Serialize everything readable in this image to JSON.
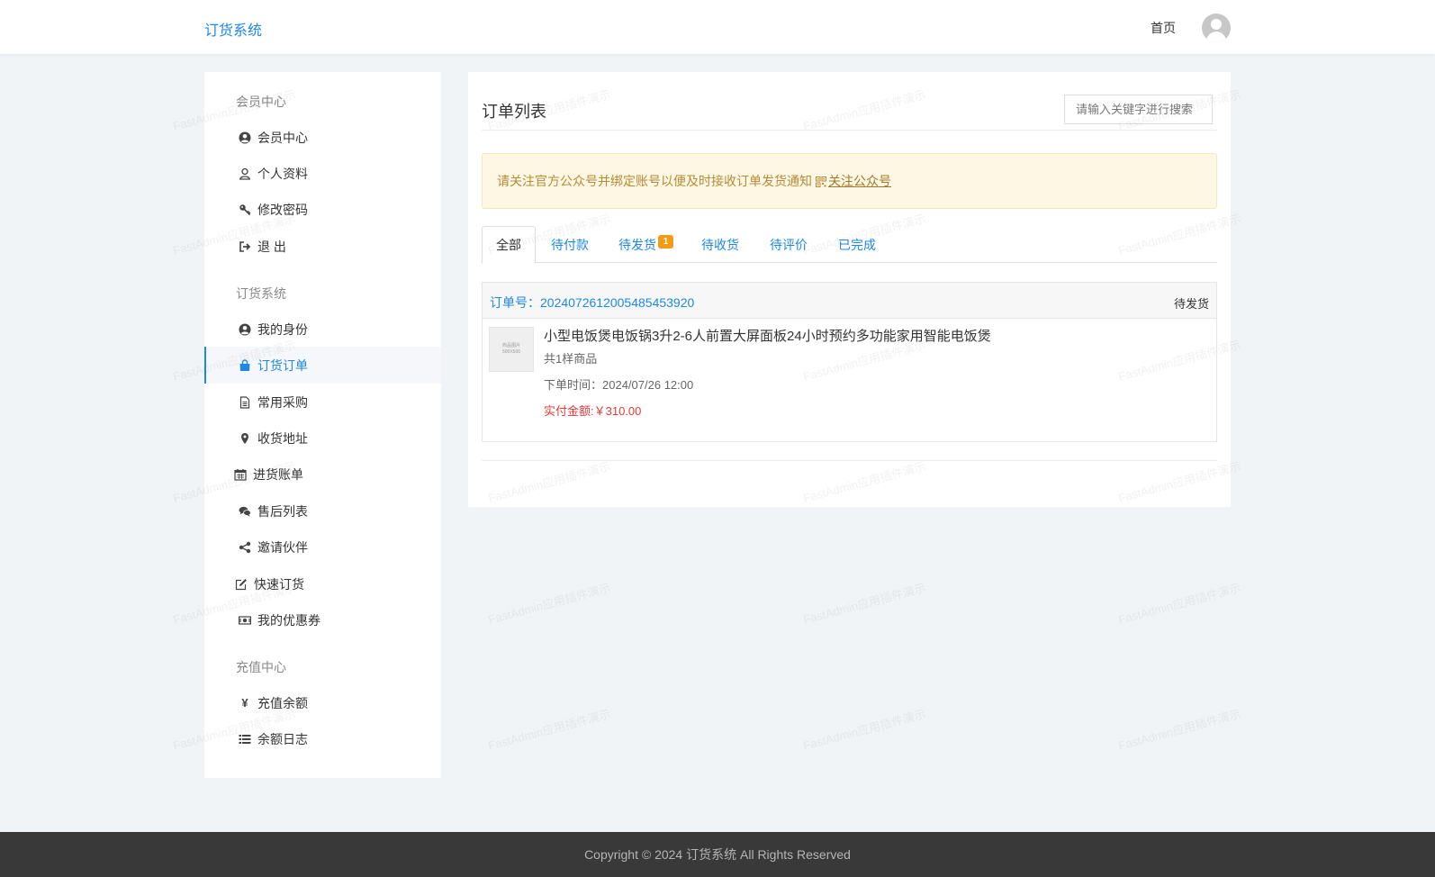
{
  "header": {
    "brand": "订货系统",
    "nav_home": "首页"
  },
  "sidebar": {
    "groups": [
      {
        "title": "会员中心",
        "items": [
          {
            "label": "会员中心",
            "icon": "user-circle-icon"
          },
          {
            "label": "个人资料",
            "icon": "user-outline-icon"
          },
          {
            "label": "修改密码",
            "icon": "key-icon"
          },
          {
            "label": "退 出",
            "icon": "sign-out-icon"
          }
        ]
      },
      {
        "title": "订货系统",
        "items": [
          {
            "label": "我的身份",
            "icon": "user-circle-icon"
          },
          {
            "label": "订货订单",
            "icon": "shopping-bag-icon",
            "active": true
          },
          {
            "label": "常用采购",
            "icon": "file-text-icon"
          },
          {
            "label": "收货地址",
            "icon": "map-marker-icon"
          },
          {
            "label": "进货账单",
            "icon": "calendar-icon"
          },
          {
            "label": "售后列表",
            "icon": "comments-icon"
          },
          {
            "label": "邀请伙伴",
            "icon": "share-icon"
          },
          {
            "label": "快速订货",
            "icon": "edit-icon"
          },
          {
            "label": "我的优惠券",
            "icon": "money-icon"
          }
        ]
      },
      {
        "title": "充值中心",
        "items": [
          {
            "label": "充值余额",
            "icon": "yen-icon"
          },
          {
            "label": "余额日志",
            "icon": "list-icon"
          }
        ]
      }
    ]
  },
  "main": {
    "title": "订单列表",
    "search_placeholder": "请输入关键字进行搜索",
    "notice": {
      "text": "请关注官方公众号并绑定账号以便及时接收订单发货通知",
      "link": "关注公众号"
    },
    "tabs": [
      {
        "label": "全部",
        "active": true
      },
      {
        "label": "待付款"
      },
      {
        "label": "待发货",
        "badge": "1"
      },
      {
        "label": "待收货"
      },
      {
        "label": "待评价"
      },
      {
        "label": "已完成"
      }
    ],
    "order": {
      "no_label": "订单号：",
      "no": "20240726120054854539 20",
      "status": "待发货",
      "thumb_text": [
        "商品图片",
        "500X500"
      ],
      "product_name": "小型电饭煲电饭锅3升2-6人前置大屏面板24小时预约多功能家用智能电饭煲",
      "count": "共1样商品",
      "time_label": "下单时间：",
      "time": "2024/07/26 12:00",
      "amount_label": "实付金额:",
      "amount": "￥310.00"
    }
  },
  "footer": {
    "copyright": "Copyright © 2024 订货系统 All Rights Reserved"
  },
  "watermark": "FastAdmin应用插件演示"
}
